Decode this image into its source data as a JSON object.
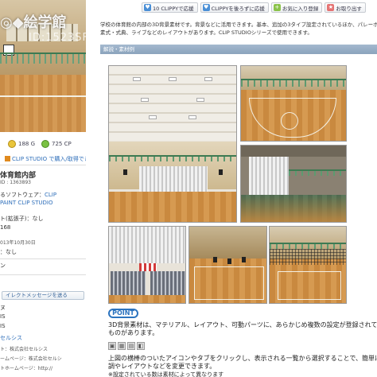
{
  "thumbnail": {
    "watermark_top": "◎◆絵学館",
    "watermark_bottom": "ID:1523SF"
  },
  "stats": {
    "gold": "188 G",
    "cp": "725 CP"
  },
  "left_link": "CLIP STUDIO で購入/取得でき",
  "info": {
    "title": "体育館内部",
    "id": "ID : 1363893",
    "software_label": "るソフトウェア：",
    "software_value1": "CLIP",
    "software_value2": "PAINT CLIP STUDIO",
    "ext_label": "ト(拡張子)：なし",
    "size": "168",
    "date": "013年10月30日",
    "tag": "：なし",
    "ban": "ン",
    "message_button": "イレクトメッセージを送る",
    "r1": "ヌ",
    "r2": "IS",
    "r3": "IS",
    "r4": "セルシス",
    "r5": "ト：株式会社セルシス",
    "r6": "ームページ：株式会社セルシ",
    "r7": "トホームページ：http://"
  },
  "toolbar": {
    "b1": "10 CLIPPYで応援",
    "b2": "CLIPPYを後ろずに応援",
    "b3": "お気に入り登録",
    "b4": "お取り出す"
  },
  "description": {
    "line1": "学校の体育館の内部の3D背景素材です。背景などに活用できます。基本、追加の3タイプ設定されているほか、パレーボ",
    "line2": "素式・式典、ライブなどのレイアウトがあります。CLIP STUDIOシリーズで使用できます。"
  },
  "section_header": "解説・素材例",
  "point": {
    "badge": "POINT",
    "line1": "3D背景素材は、マテリアル、レイアウト、可動パーツに、あらかじめ複数の設定が登録されて",
    "line2": "ものがあります。",
    "line3": "上図の横棒のついたアイコンやタブをクリックし、表示される一覧から選択することで、簡単に",
    "line4": "調やレイアウトなどを変更できます。",
    "line5": "※設定されている数は素材によって異なります"
  }
}
